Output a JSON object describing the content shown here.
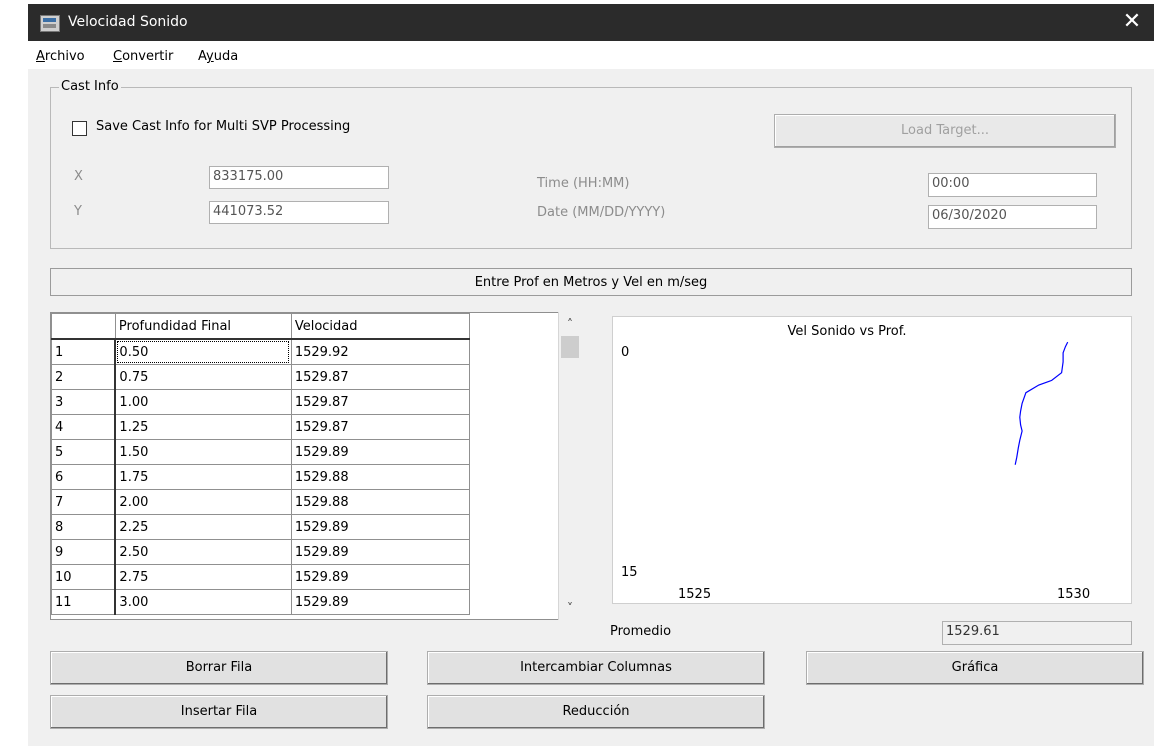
{
  "window": {
    "title": "Velocidad Sonido",
    "close_symbol": "✕"
  },
  "menu": [
    {
      "label_rest": "rchivo",
      "underline": "A"
    },
    {
      "label_rest": "onvertir",
      "underline": "C"
    },
    {
      "label_pre": "A",
      "underline": "y",
      "label_rest": "uda"
    }
  ],
  "cast_info": {
    "legend": "Cast Info",
    "save_checkbox_label": "Save Cast Info for Multi SVP Processing",
    "save_checked": false,
    "load_target_button": "Load Target...",
    "x_label": "X",
    "x_value": "833175.00",
    "y_label": "Y",
    "y_value": "441073.52",
    "time_label": "Time (HH:MM)",
    "time_value": "00:00",
    "date_label": "Date (MM/DD/YYYY)",
    "date_value": "06/30/2020"
  },
  "banner": "Entre Prof en Metros y Vel en m/seg",
  "table": {
    "headers": [
      "Profundidad Final",
      "Velocidad"
    ],
    "rows": [
      [
        "1",
        "0.50",
        "1529.92"
      ],
      [
        "2",
        "0.75",
        "1529.87"
      ],
      [
        "3",
        "1.00",
        "1529.87"
      ],
      [
        "4",
        "1.25",
        "1529.87"
      ],
      [
        "5",
        "1.50",
        "1529.89"
      ],
      [
        "6",
        "1.75",
        "1529.88"
      ],
      [
        "7",
        "2.00",
        "1529.88"
      ],
      [
        "8",
        "2.25",
        "1529.89"
      ],
      [
        "9",
        "2.50",
        "1529.89"
      ],
      [
        "10",
        "2.75",
        "1529.89"
      ],
      [
        "11",
        "3.00",
        "1529.89"
      ]
    ]
  },
  "chart": {
    "title": "Vel Sonido vs Prof.",
    "y_top_label": "0",
    "y_bottom_label": "15",
    "x_left_label": "1525",
    "x_right_label": "1530",
    "line_color": "#0000ff"
  },
  "chart_data": {
    "type": "line",
    "title": "Vel Sonido vs Prof.",
    "xlim": [
      1525,
      1530
    ],
    "ylim": [
      0,
      15
    ],
    "y_inverted": true,
    "series": [
      {
        "x": [
          1529.93,
          1529.9,
          1529.87,
          1529.87,
          1529.85,
          1529.72,
          1529.55,
          1529.38,
          1529.33,
          1529.31,
          1529.3,
          1529.31,
          1529.33,
          1529.3,
          1529.28,
          1529.26,
          1529.24
        ],
        "y": [
          0.2,
          0.5,
          0.9,
          1.5,
          2.2,
          2.7,
          3.0,
          3.5,
          4.2,
          4.7,
          5.1,
          5.6,
          6.0,
          6.6,
          7.1,
          7.7,
          8.2
        ]
      }
    ]
  },
  "promedio": {
    "label": "Promedio",
    "value": "1529.61"
  },
  "buttons": {
    "borrar": "Borrar Fila",
    "intercambiar": "Intercambiar Columnas",
    "grafica": "Gráfica",
    "insertar": "Insertar Fila",
    "reduccion": "Reducción"
  }
}
